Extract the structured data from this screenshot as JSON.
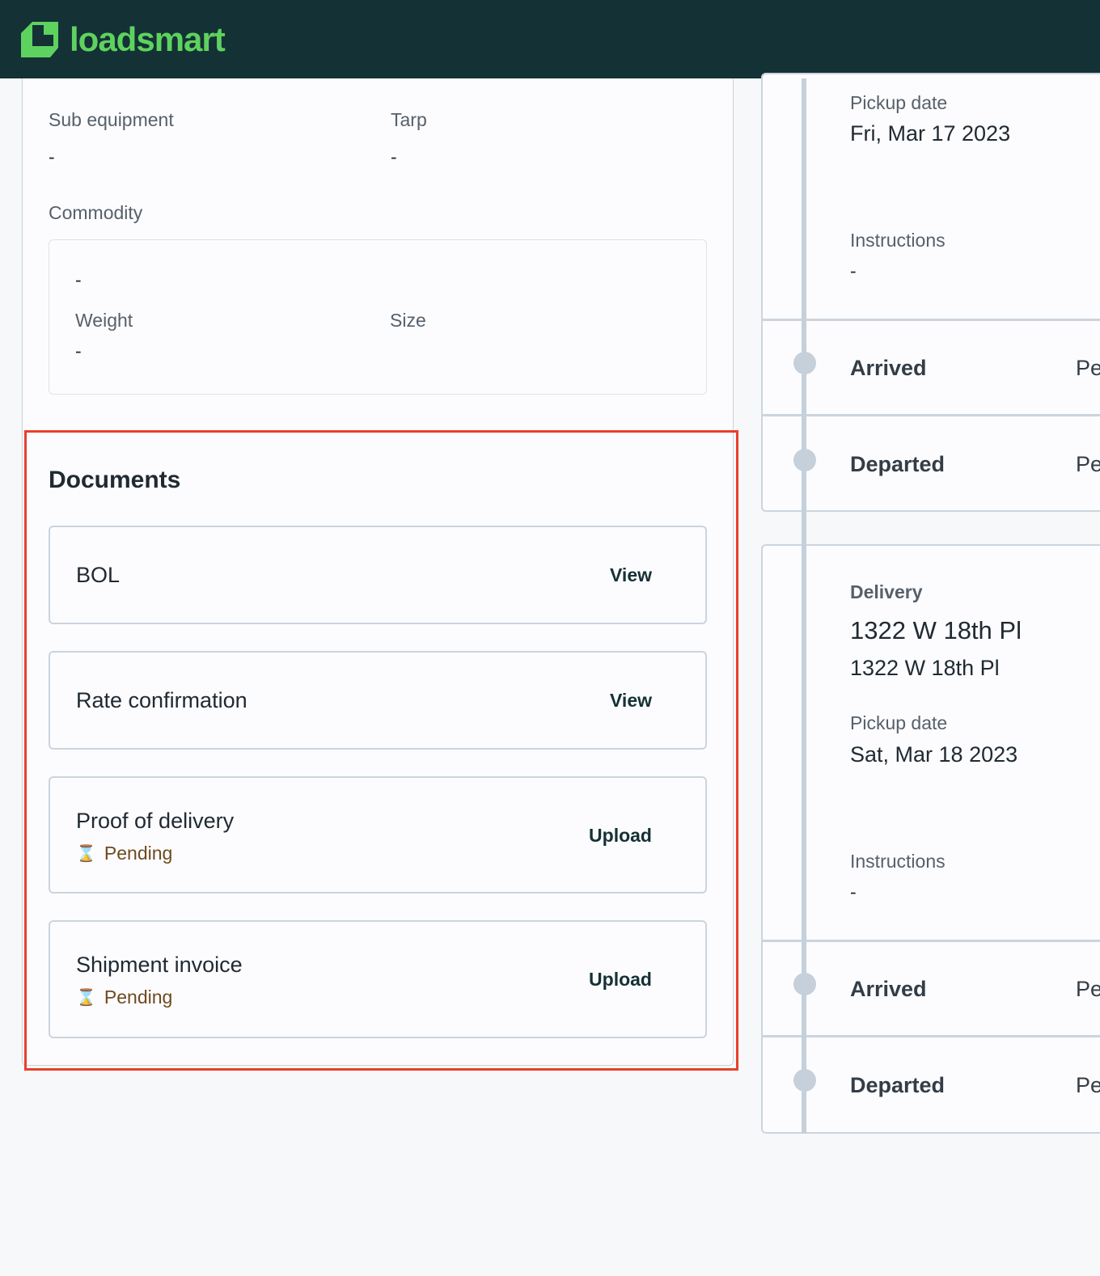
{
  "header": {
    "brand": "loadsmart",
    "brand_color": "#5ed25e",
    "bg_color": "#143136"
  },
  "details": {
    "sub_equipment_label": "Sub equipment",
    "sub_equipment_value": "-",
    "tarp_label": "Tarp",
    "tarp_value": "-",
    "commodity_label": "Commodity",
    "commodity_value": "-",
    "weight_label": "Weight",
    "weight_value": "-",
    "size_label": "Size"
  },
  "documents": {
    "title": "Documents",
    "items": [
      {
        "name": "BOL",
        "action": "View"
      },
      {
        "name": "Rate confirmation",
        "action": "View"
      },
      {
        "name": "Proof of delivery",
        "action": "Upload",
        "status": "Pending",
        "status_icon": "hourglass-icon"
      },
      {
        "name": "Shipment invoice",
        "action": "Upload",
        "status": "Pending",
        "status_icon": "hourglass-icon"
      }
    ]
  },
  "stops": [
    {
      "date_label": "Pickup date",
      "date": "Fri, Mar 17 2023",
      "instructions_label": "Instructions",
      "instructions": "-",
      "events": [
        {
          "name": "Arrived",
          "status": "Pending"
        },
        {
          "name": "Departed",
          "status": "Pending"
        }
      ]
    },
    {
      "type": "Delivery",
      "name": "1322 W 18th Pl",
      "address": "1322 W 18th Pl",
      "date_label": "Pickup date",
      "date": "Sat, Mar 18 2023",
      "instructions_label": "Instructions",
      "instructions": "-",
      "events": [
        {
          "name": "Arrived",
          "status": "Pending"
        },
        {
          "name": "Departed",
          "status": "Pending"
        }
      ]
    }
  ],
  "highlight_color": "#e8402c"
}
